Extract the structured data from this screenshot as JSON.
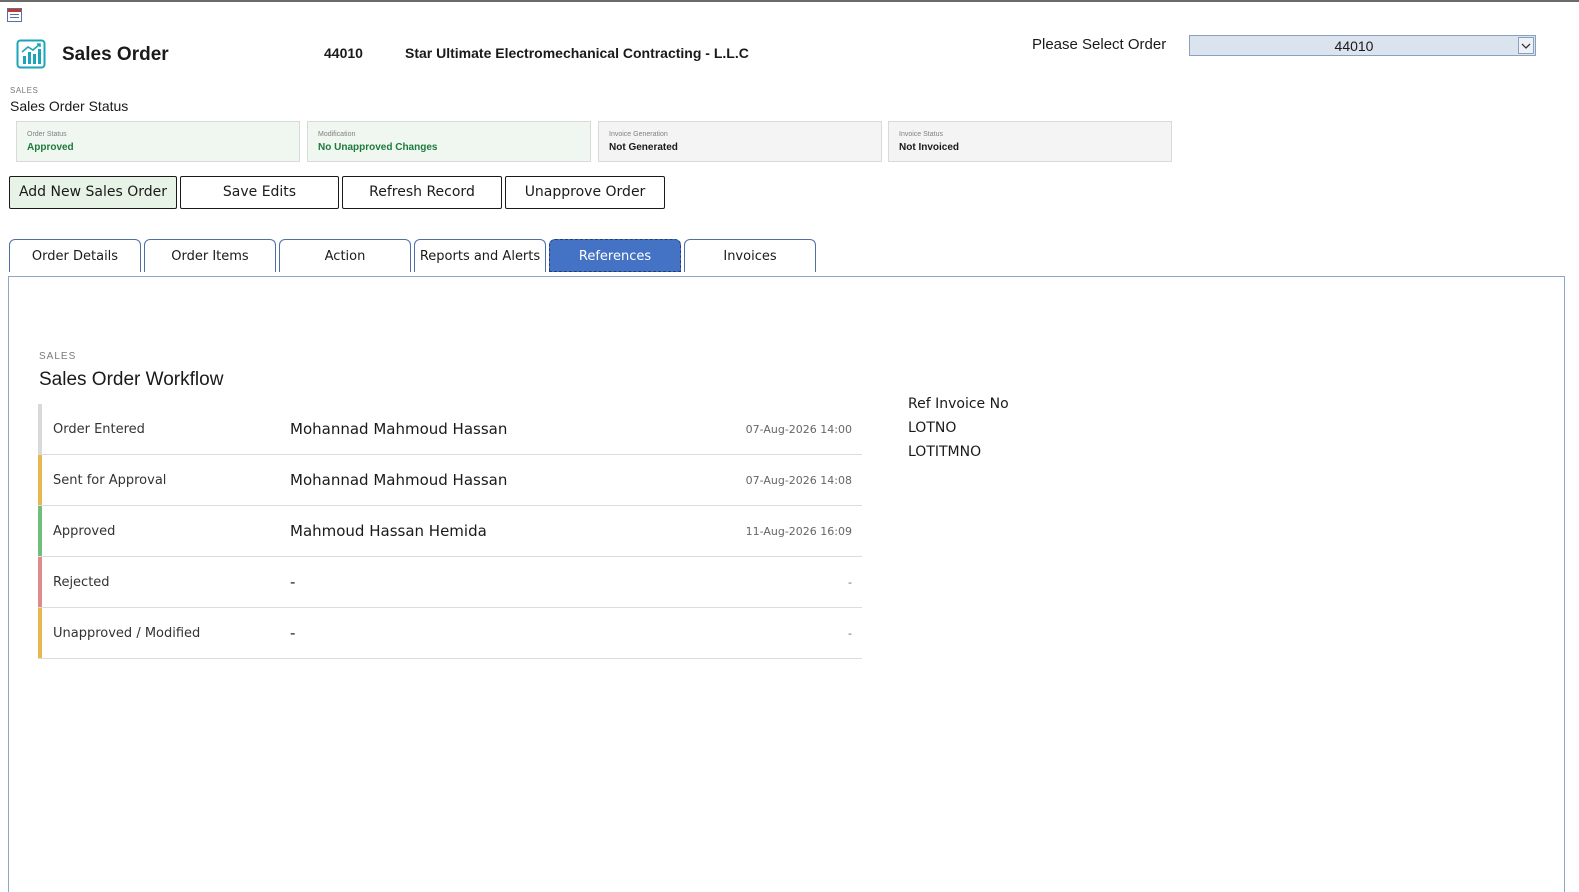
{
  "header": {
    "title": "Sales Order",
    "order_number": "44010",
    "customer_name": "Star Ultimate Electromechanical Contracting - L.L.C"
  },
  "order_selector": {
    "label": "Please Select Order",
    "selected": "44010"
  },
  "status_section": {
    "caption": "SALES",
    "title": "Sales Order Status",
    "cards": [
      {
        "caption": "Order Status",
        "value": "Approved",
        "tone": "green"
      },
      {
        "caption": "Modification",
        "value": "No Unapproved Changes",
        "tone": "green"
      },
      {
        "caption": "Invoice Generation",
        "value": "Not Generated",
        "tone": "gray"
      },
      {
        "caption": "Invoice Status",
        "value": "Not Invoiced",
        "tone": "gray"
      }
    ]
  },
  "actions": {
    "add_new": "Add New Sales Order",
    "save": "Save Edits",
    "refresh": "Refresh Record",
    "unapprove": "Unapprove Order"
  },
  "tabs": [
    {
      "label": "Order Details",
      "active": false
    },
    {
      "label": "Order Items",
      "active": false
    },
    {
      "label": "Action",
      "active": false
    },
    {
      "label": "Reports and Alerts",
      "active": false
    },
    {
      "label": "References",
      "active": true
    },
    {
      "label": "Invoices",
      "active": false
    }
  ],
  "workflow": {
    "caption": "SALES",
    "title": "Sales Order Workflow",
    "rows": [
      {
        "stage": "Order Entered",
        "user": "Mohannad Mahmoud Hassan",
        "time": "07-Aug-2026 14:00",
        "color": "#d9d9d9"
      },
      {
        "stage": "Sent for Approval",
        "user": "Mohannad Mahmoud Hassan",
        "time": "07-Aug-2026 14:08",
        "color": "#e6b84f"
      },
      {
        "stage": "Approved",
        "user": "Mahmoud Hassan Hemida",
        "time": "11-Aug-2026 16:09",
        "color": "#6fbf7b"
      },
      {
        "stage": "Rejected",
        "user": "-",
        "time": "-",
        "color": "#e08a8a"
      },
      {
        "stage": "Unapproved / Modified",
        "user": "-",
        "time": "-",
        "color": "#e6b84f"
      }
    ]
  },
  "references": {
    "items": [
      "Ref Invoice No",
      "LOTNO",
      "LOTITMNO"
    ]
  },
  "colors": {
    "accent": "#4472c4",
    "green_text": "#1e7a3a",
    "app_icon": "#1aa5b8"
  },
  "icons": {
    "app": "chart-growth-icon",
    "form": "form-window-icon",
    "dropdown": "chevron-down-icon"
  }
}
